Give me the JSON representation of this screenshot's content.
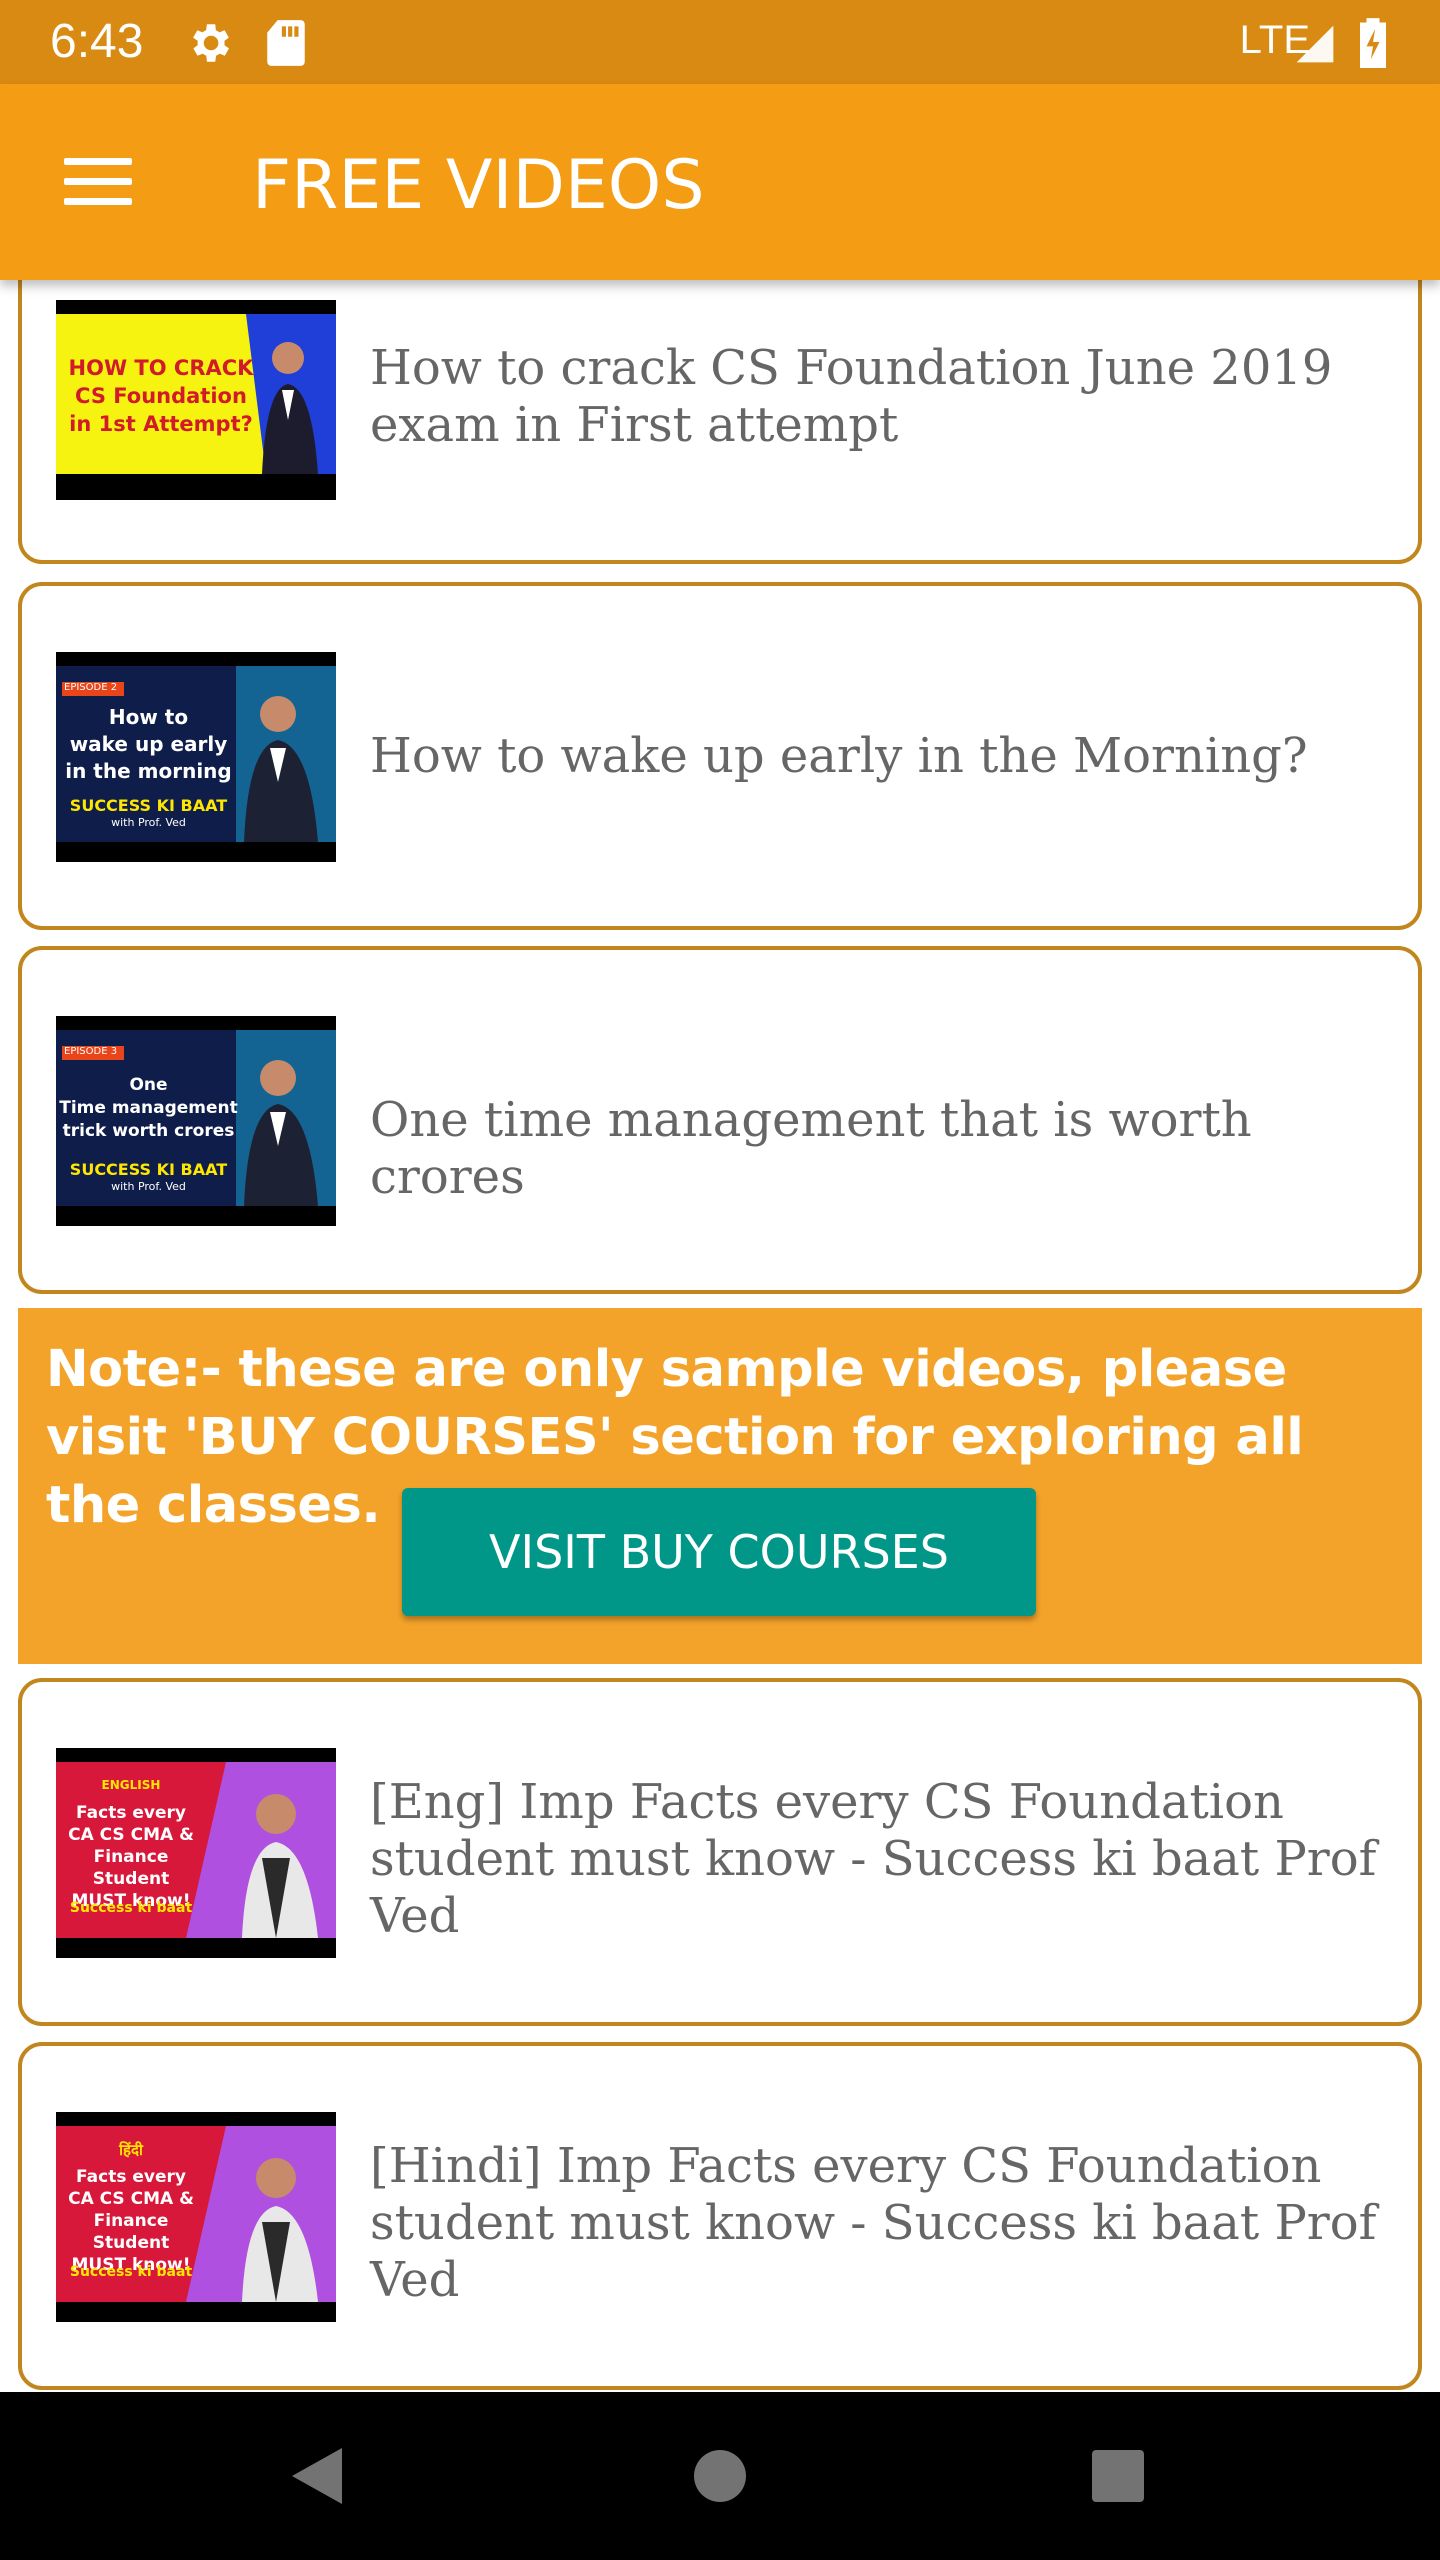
{
  "status_bar": {
    "time": "6:43",
    "network": "LTE"
  },
  "app_bar": {
    "title": "FREE VIDEOS",
    "menu_icon": "hamburger-menu-icon"
  },
  "videos": [
    {
      "title": "How to crack CS Foundation June 2019 exam in First attempt",
      "thumb": {
        "line1": "HOW TO CRACK",
        "line2": "CS Foundation",
        "line3": "in 1st Attempt?"
      }
    },
    {
      "title": "How to wake up early in the Morning?",
      "thumb": {
        "episode": "EPISODE 2",
        "line1": "How to",
        "line2": "wake up early",
        "line3": "in the morning",
        "brand": "SUCCESS KI BAAT",
        "sub": "with Prof. Ved"
      }
    },
    {
      "title": "One time management that is worth crores",
      "thumb": {
        "episode": "EPISODE 3",
        "line1": "One",
        "line2": "Time management",
        "line3": "trick worth crores",
        "brand": "SUCCESS KI BAAT",
        "sub": "with Prof. Ved"
      }
    },
    {
      "title": "[Eng] Imp Facts every CS Foundation student must know - Success ki baat Prof Ved",
      "thumb": {
        "lang": "ENGLISH",
        "line1": "Facts every",
        "line2": "CA CS CMA &",
        "line3": "Finance Student",
        "line4": "MUST know!",
        "brand": "Success ki baat"
      }
    },
    {
      "title": "[Hindi] Imp Facts every CS Foundation student must know - Success ki baat Prof Ved",
      "thumb": {
        "lang": "हिंदी",
        "line1": "Facts every",
        "line2": "CA CS CMA &",
        "line3": "Finance Student",
        "line4": "MUST know!",
        "brand": "Success ki baat"
      }
    }
  ],
  "note": {
    "text": "Note:- these are only sample videos, please visit 'BUY COURSES' section for exploring all the classes.",
    "button_label": "VISIT BUY COURSES"
  },
  "colors": {
    "status_bar": "#d98a12",
    "app_bar": "#f39c14",
    "note_bg": "#f4a32a",
    "button": "#009688",
    "card_border": "#c1861d"
  }
}
